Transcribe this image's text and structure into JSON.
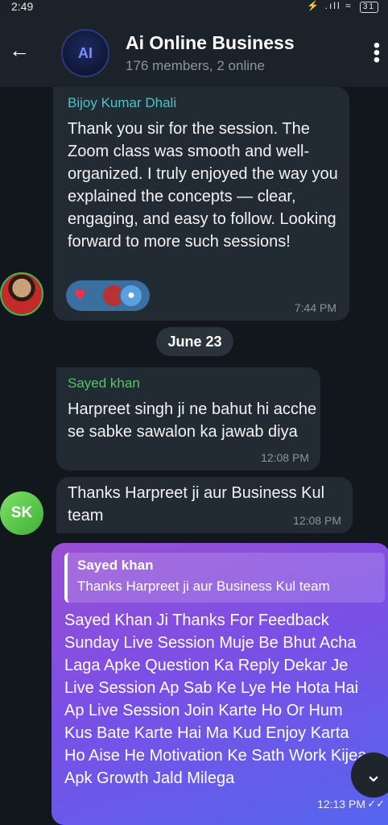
{
  "status": {
    "time": "2:49",
    "icons": "⚡ .ıll ≈",
    "battery": "31"
  },
  "header": {
    "back_icon": "←",
    "avatar_text": "AI",
    "title": "Ai Online Business",
    "subtitle": "176 members, 2 online",
    "menu_icon": "⋮"
  },
  "messages": [
    {
      "sender": "Bijoy Kumar Dhali",
      "text": "Thank you sir for the session. The Zoom class was smooth and well-organized. I truly enjoyed the way you explained the concepts — clear, engaging, and easy to follow. Looking forward to more such sessions!",
      "time": "7:44 PM",
      "reactions": [
        "heart",
        "user-photo",
        "user-icon"
      ]
    },
    {
      "sender": "Sayed khan",
      "text": "Harpreet singh ji ne bahut hi acche se sabke sawalon ka jawab diya",
      "time": "12:08 PM"
    },
    {
      "sender_initials": "SK",
      "text": "Thanks Harpreet ji aur Business Kul team",
      "time": "12:08 PM"
    },
    {
      "reply_to_name": "Sayed khan",
      "reply_to_text": "Thanks Harpreet ji aur Business Kul team",
      "text": "Sayed Khan Ji Thanks For Feedback Sunday Live Session Muje Be Bhut Acha Laga Apke Question Ka Reply Dekar Je Live Session Ap Sab Ke Lye He Hota Hai Ap Live Session Join Karte Ho Or Hum Kus Bate Karte Hai Ma Kud Enjoy Karta Ho Aise He Motivation Ke Sath Work Kijea Apk Growth Jald Milega",
      "time": "12:13 PM",
      "status_icon": "✓✓"
    }
  ],
  "date_separator": "June 23",
  "scroll_down_icon": "⌄",
  "colors": {
    "outgoing_start": "#9a4fd4",
    "outgoing_end": "#5566ee",
    "incoming": "#222a33",
    "sender1": "#4fc3c3",
    "sender2": "#59c26a"
  }
}
